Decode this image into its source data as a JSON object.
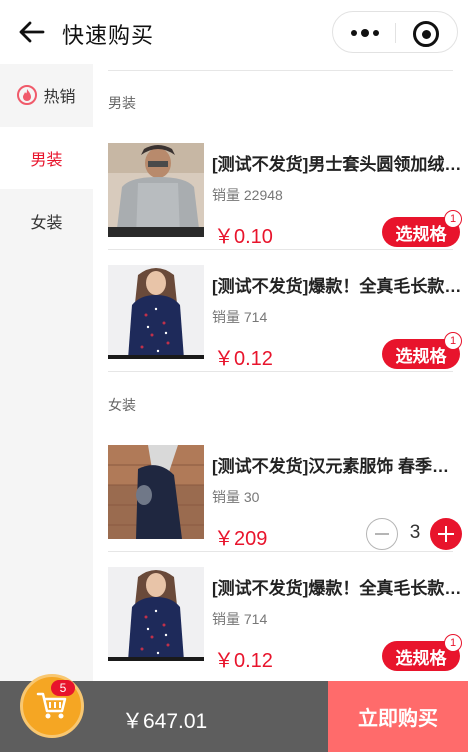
{
  "header": {
    "title": "快速购买",
    "back_icon": "arrow-left-icon",
    "more_icon": "more-dots-icon",
    "close_icon": "circle-close-icon"
  },
  "sidebar": {
    "items": [
      {
        "label": "热销",
        "icon": "fire-icon",
        "active": false
      },
      {
        "label": "男装",
        "active": true
      },
      {
        "label": "女装",
        "active": false
      }
    ]
  },
  "sections": [
    {
      "title": "男装",
      "products": [
        {
          "name": "[测试不发货]男士套头圆领加绒卫衣",
          "sales": "销量 22948",
          "price": "￥0.10",
          "action": "选规格",
          "badge": "1"
        },
        {
          "name": "[测试不发货]爆款！全真毛长款大衣",
          "sales": "销量 714",
          "price": "￥0.12",
          "action": "选规格",
          "badge": "1"
        }
      ]
    },
    {
      "title": "女装",
      "products": [
        {
          "name": "[测试不发货]汉元素服饰 春季新款外套",
          "sales": "销量 30",
          "price": "￥209",
          "quantity": "3"
        },
        {
          "name": "[测试不发货]爆款！全真毛长款大衣",
          "sales": "销量 714",
          "price": "￥0.12",
          "action": "选规格",
          "badge": "1"
        }
      ]
    }
  ],
  "cart": {
    "icon": "shopping-cart-icon",
    "count": "5",
    "total": "￥647.01",
    "buy_label": "立即购买"
  },
  "colors": {
    "accent": "#e8142c",
    "cart": "#f5a623",
    "buy_button": "#ff6b6b",
    "bottom_bar": "#5e5e5e"
  }
}
